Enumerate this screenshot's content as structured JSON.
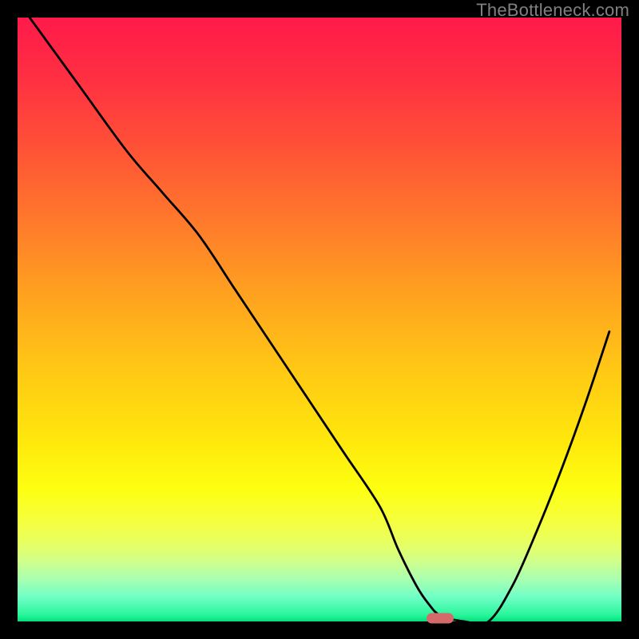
{
  "watermark": "TheBottleneck.com",
  "colors": {
    "gradient_top": "#ff1a4a",
    "gradient_bottom": "#00e07c",
    "curve": "#000000",
    "marker": "#d46a6a",
    "frame": "#000000"
  },
  "chart_data": {
    "type": "line",
    "title": "",
    "xlabel": "",
    "ylabel": "",
    "xlim": [
      0,
      100
    ],
    "ylim": [
      0,
      100
    ],
    "grid": false,
    "legend": false,
    "series": [
      {
        "name": "bottleneck-curve",
        "x": [
          2,
          10,
          18,
          24,
          30,
          36,
          42,
          48,
          54,
          60,
          63,
          66,
          68,
          70,
          74,
          78,
          82,
          86,
          90,
          94,
          98
        ],
        "values": [
          100,
          89,
          78,
          71,
          64,
          55,
          46,
          37,
          28,
          19,
          12,
          6,
          3,
          1,
          0,
          0,
          6,
          15,
          25,
          36,
          48
        ]
      }
    ],
    "annotations": [
      {
        "name": "optimal-marker",
        "x": 70,
        "y": 0.5,
        "shape": "pill",
        "color": "#d46a6a"
      }
    ]
  }
}
